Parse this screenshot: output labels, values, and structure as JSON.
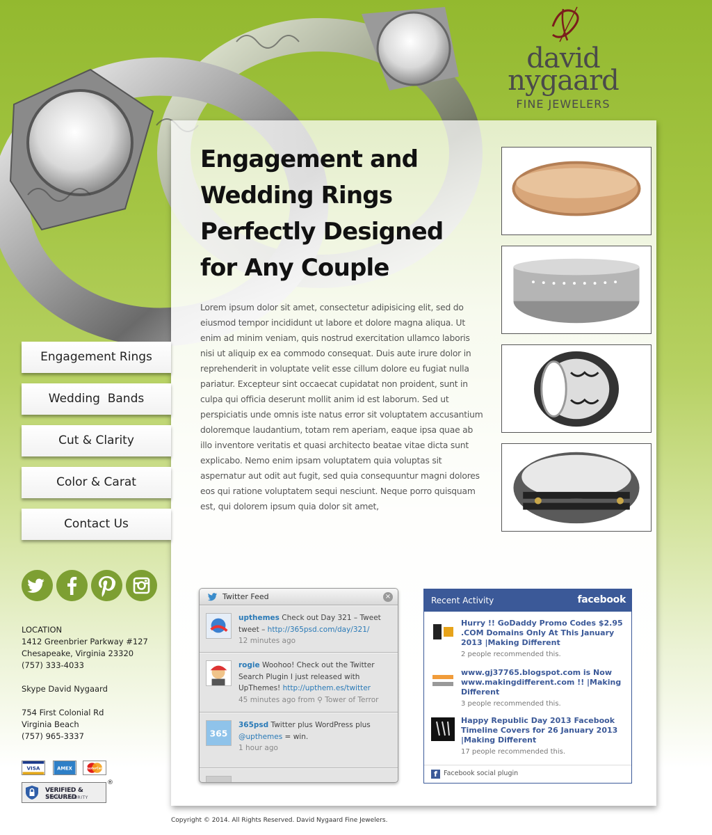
{
  "brand": {
    "line1": "david",
    "line2": "nygaard",
    "line3": "FINE JEWELERS"
  },
  "headline": "Engagement and Wedding Rings Perfectly Designed for Any Couple",
  "body": "Lorem ipsum dolor sit amet, consectetur adipisicing elit, sed do eiusmod tempor incididunt ut labore et dolore magna aliqua. Ut enim ad minim veniam, quis nostrud exercitation ullamco laboris nisi ut aliquip ex ea commodo consequat. Duis aute irure dolor in reprehenderit in voluptate velit esse cillum dolore eu fugiat nulla pariatur. Excepteur sint occaecat cupidatat non proident, sunt in culpa qui officia deserunt mollit anim id est laborum. Sed ut perspiciatis unde omnis iste natus error sit voluptatem accusantium doloremque laudantium, totam rem aperiam, eaque ipsa quae ab illo inventore veritatis et quasi architecto beatae vitae dicta sunt explicabo. Nemo enim ipsam voluptatem quia voluptas sit aspernatur aut odit aut fugit, sed quia consequuntur magni dolores eos qui ratione voluptatem sequi nesciunt. Neque porro quisquam est, qui dolorem ipsum quia dolor sit amet,",
  "nav": {
    "items": [
      {
        "label": "Engagement Rings"
      },
      {
        "label": "Wedding  Bands"
      },
      {
        "label": "Cut & Clarity"
      },
      {
        "label": "Color & Carat"
      },
      {
        "label": "Contact Us"
      }
    ]
  },
  "social": [
    "twitter-icon",
    "facebook-icon",
    "pinterest-icon",
    "instagram-icon"
  ],
  "contact": {
    "heading": "LOCATION",
    "address1": "1412 Greenbrier Parkway #127",
    "address2": "Chesapeake, Virginia 23320",
    "phone1": "(757) 333-4033",
    "skype": "Skype David Nygaard",
    "address3": "754 First Colonial Rd",
    "address4": "Virginia Beach",
    "phone2": "(757) 965-3337"
  },
  "payment": {
    "visa": "VISA",
    "amex": "AMEX",
    "mastercard": "MasterCard",
    "verified_line1": "VERIFIED & SECURED",
    "verified_line2": "VERIFY SECURITY",
    "registered": "®"
  },
  "twitter": {
    "title": "Twitter Feed",
    "close": "×",
    "tweets": [
      {
        "user": "upthemes",
        "text": " Check out Day 321 – Tweet tweet – ",
        "link": "http://365psd.com/day/321/",
        "time": "12 minutes ago"
      },
      {
        "user": "rogie",
        "text": " Woohoo! Check out the Twitter Search Plugin I just released with UpThemes! ",
        "link": "http://upthem.es/twitter",
        "time": "45 minutes ago from  ⚲ Tower of Terror"
      },
      {
        "user": "365psd",
        "text": " Twitter plus WordPress plus ",
        "link": "@upthemes",
        "tail": " = win.",
        "time": "1 hour ago"
      }
    ]
  },
  "facebook": {
    "title": "Recent Activity",
    "brand": "facebook",
    "items": [
      {
        "title": "Hurry !! GoDaddy Promo Codes $2.95 .COM Domains Only At This January 2013 |Making Different",
        "meta": "2 people recommended this."
      },
      {
        "title": "www.gj37765.blogspot.com is Now www.makingdifferent.com !! |Making Different",
        "meta": "3 people recommended this."
      },
      {
        "title": "Happy Republic Day 2013 Facebook Timeline Covers for 26 January 2013 |Making Different",
        "meta": "17 people recommended this."
      }
    ],
    "footer": "Facebook social plugin"
  },
  "copyright": "Copyright © 2014. All Rights Reserved. David Nygaard Fine Jewelers.",
  "colors": {
    "green_top": "#93b92f",
    "social_green": "#7d9f32",
    "facebook_blue": "#3b5998",
    "twitter_link": "#2a7ab7"
  }
}
